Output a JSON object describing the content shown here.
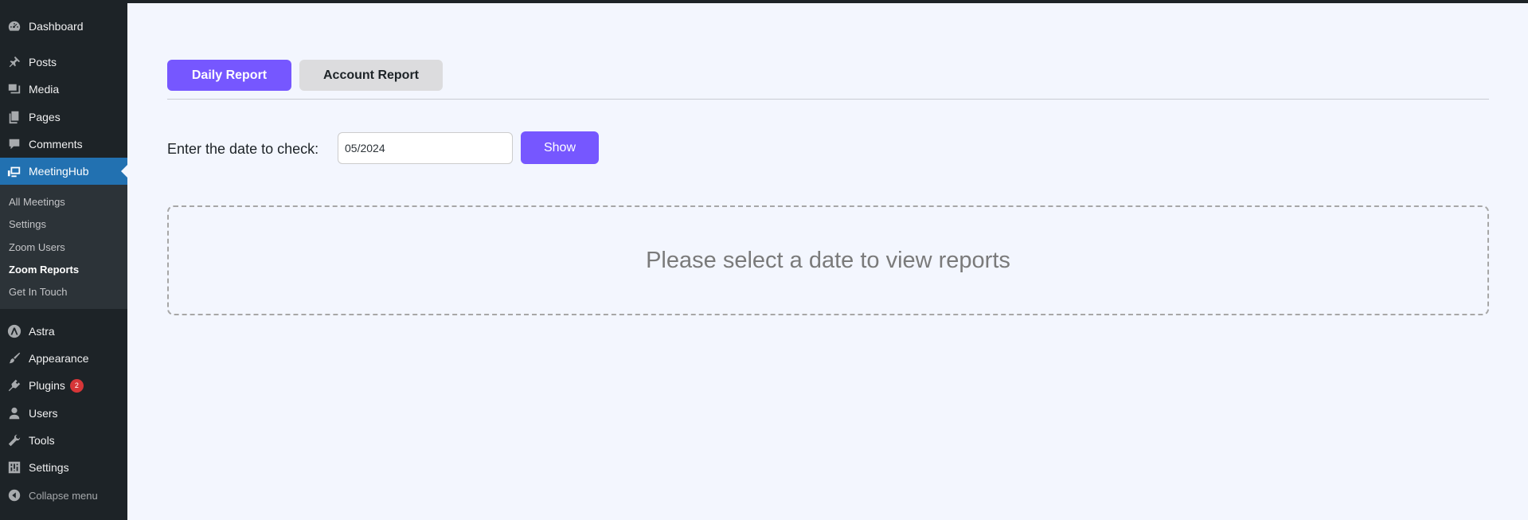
{
  "sidebar": {
    "dashboard": "Dashboard",
    "posts": "Posts",
    "media": "Media",
    "pages": "Pages",
    "comments": "Comments",
    "meetinghub": "MeetingHub",
    "submenu": {
      "all_meetings": "All Meetings",
      "settings": "Settings",
      "zoom_users": "Zoom Users",
      "zoom_reports": "Zoom Reports",
      "get_in_touch": "Get In Touch"
    },
    "astra": "Astra",
    "appearance": "Appearance",
    "plugins": "Plugins",
    "plugins_badge": "2",
    "users": "Users",
    "tools": "Tools",
    "settings": "Settings",
    "collapse": "Collapse menu"
  },
  "tabs": {
    "daily": "Daily Report",
    "account": "Account Report"
  },
  "form": {
    "label": "Enter the date to check:",
    "date_value": "05/2024",
    "show_button": "Show"
  },
  "report": {
    "placeholder": "Please select a date to view reports"
  },
  "colors": {
    "accent": "#7657ff",
    "sidebar_bg": "#1d2327",
    "active_menu": "#2271b1",
    "badge": "#d63638"
  }
}
